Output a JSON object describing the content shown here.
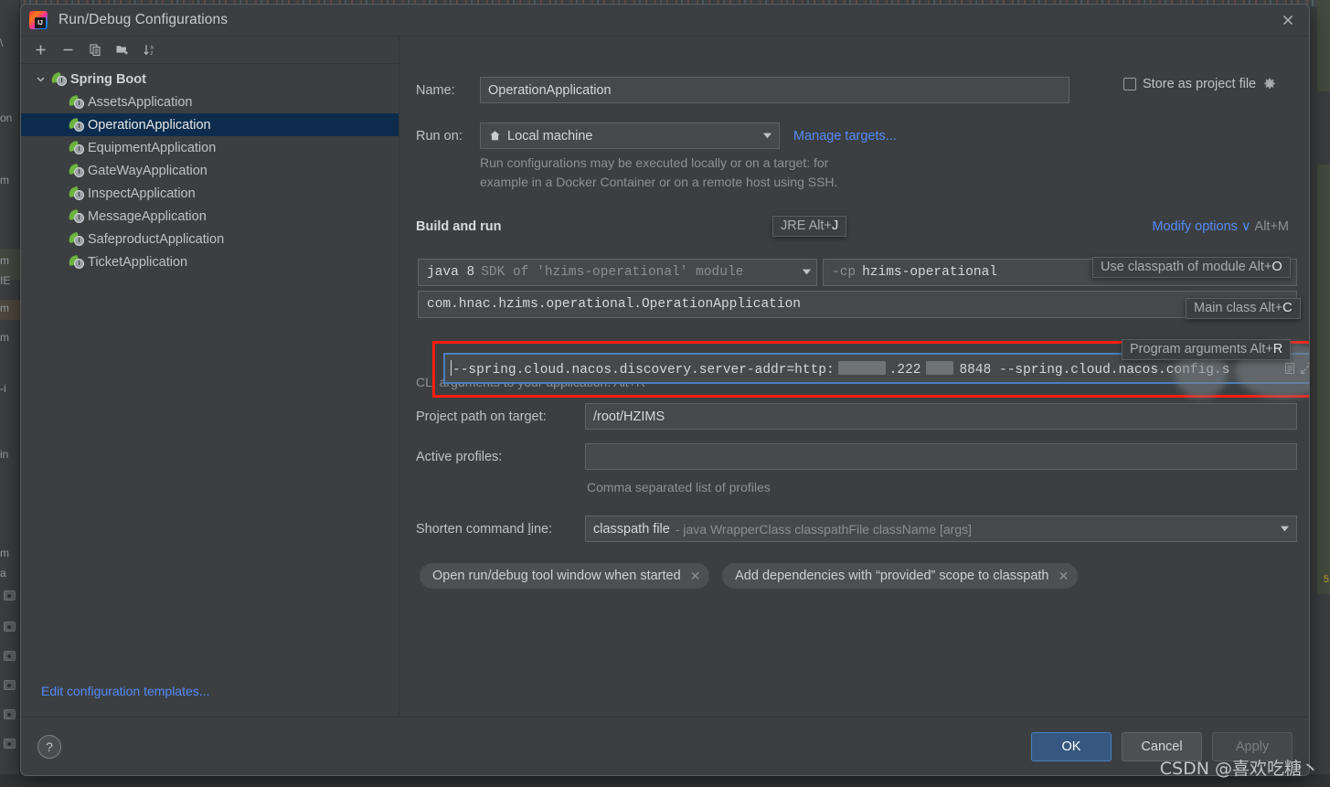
{
  "window": {
    "title": "Run/Debug Configurations",
    "logo_icon": "intellij-idea-logo",
    "close_icon": "close-icon"
  },
  "toolbar": {
    "buttons": [
      {
        "name": "add-configuration-button",
        "icon": "plus-icon"
      },
      {
        "name": "remove-configuration-button",
        "icon": "minus-icon"
      },
      {
        "name": "copy-configuration-button",
        "icon": "copy-icon"
      },
      {
        "name": "new-folder-button",
        "icon": "folder-add-icon"
      },
      {
        "name": "sort-button",
        "icon": "sort-az-icon"
      }
    ]
  },
  "sidebar": {
    "group": {
      "label": "Spring Boot",
      "expanded": true,
      "icon": "spring-boot-icon"
    },
    "items": [
      {
        "label": "AssetsApplication",
        "selected": false
      },
      {
        "label": "OperationApplication",
        "selected": true
      },
      {
        "label": "EquipmentApplication",
        "selected": false
      },
      {
        "label": "GateWayApplication",
        "selected": false
      },
      {
        "label": "InspectApplication",
        "selected": false
      },
      {
        "label": "MessageApplication",
        "selected": false
      },
      {
        "label": "SafeproductApplication",
        "selected": false
      },
      {
        "label": "TicketApplication",
        "selected": false
      }
    ],
    "edit_templates_link": "Edit configuration templates..."
  },
  "form": {
    "name_label": "Name:",
    "name_value": "OperationApplication",
    "store_as_project_file_label": "Store as project file",
    "store_as_project_file_checked": false,
    "store_gear_icon": "gear-icon",
    "run_on_label": "Run on:",
    "run_on_value": "Local machine",
    "run_on_icon": "home-icon",
    "manage_targets_link": "Manage targets...",
    "run_on_hint_line1": "Run configurations may be executed locally or on a target: for",
    "run_on_hint_line2": "example in a Docker Container or on a remote host using SSH.",
    "build_and_run_title": "Build and run",
    "modify_options_label": "Modify options",
    "modify_options_shortcut": "Alt+M",
    "jre_value_bold": "java 8",
    "jre_value_dim": "SDK of 'hzims-operational' module",
    "classpath_value_dim": "-cp",
    "classpath_value_bold": "hzims-operational",
    "main_class_value": "com.hnac.hzims.operational.OperationApplication",
    "main_class_icon": "expand-editor-icon",
    "program_arguments_value_prefix": "--spring.cloud.nacos.discovery.server-addr=http:",
    "program_arguments_value_middle": ".222",
    "program_arguments_value_suffix": "8848 --spring.cloud.nacos.config.s",
    "program_arguments_copy_icon": "copy-icon",
    "program_arguments_expand_icon": "expand-arrow-icon",
    "cli_hint": "CLI arguments to your application. Alt+R",
    "project_path_label": "Project path on target:",
    "project_path_value": "/root/HZIMS",
    "active_profiles_label": "Active profiles:",
    "active_profiles_value": "",
    "active_profiles_hint": "Comma separated list of profiles",
    "shorten_command_line_label_pre": "Shorten command ",
    "shorten_command_line_label_underline": "l",
    "shorten_command_line_label_post": "ine:",
    "shorten_command_line_value": "classpath file",
    "shorten_command_line_value_dim": "- java WrapperClass classpathFile className [args]",
    "chips": [
      "Open run/debug tool window when started",
      "Add dependencies with “provided” scope to classpath"
    ]
  },
  "tooltips": [
    {
      "name": "jre-shortcut-tip",
      "text": "JRE Alt+J",
      "underline": "J"
    },
    {
      "name": "use-classpath-of-module-shortcut-tip",
      "text": "Use classpath of module Alt+O",
      "underline": "O"
    },
    {
      "name": "main-class-shortcut-tip",
      "text": "Main class Alt+C",
      "underline": "C"
    },
    {
      "name": "program-arguments-shortcut-tip",
      "text": "Program arguments Alt+R",
      "underline": "R"
    }
  ],
  "footer": {
    "help_icon": "question-mark-icon",
    "ok_label": "OK",
    "cancel_label": "Cancel",
    "apply_label": "Apply",
    "apply_disabled": true
  },
  "watermark": "CSDN @喜欢吃糖丶",
  "colors": {
    "accent_link": "#548af7",
    "selection": "#0d2c4d",
    "highlight_box": "#fd1d11",
    "primary_button": "#365880",
    "spring_green": "#6db33f",
    "panel_bg": "#3c3f41",
    "field_bg": "#45494a"
  },
  "background_editor": {
    "left_fragments": [
      "\\",
      "on",
      "m",
      "m",
      "IE",
      "m",
      "m",
      "-i",
      "in",
      "m",
      "a"
    ],
    "right_fragment": "5"
  }
}
